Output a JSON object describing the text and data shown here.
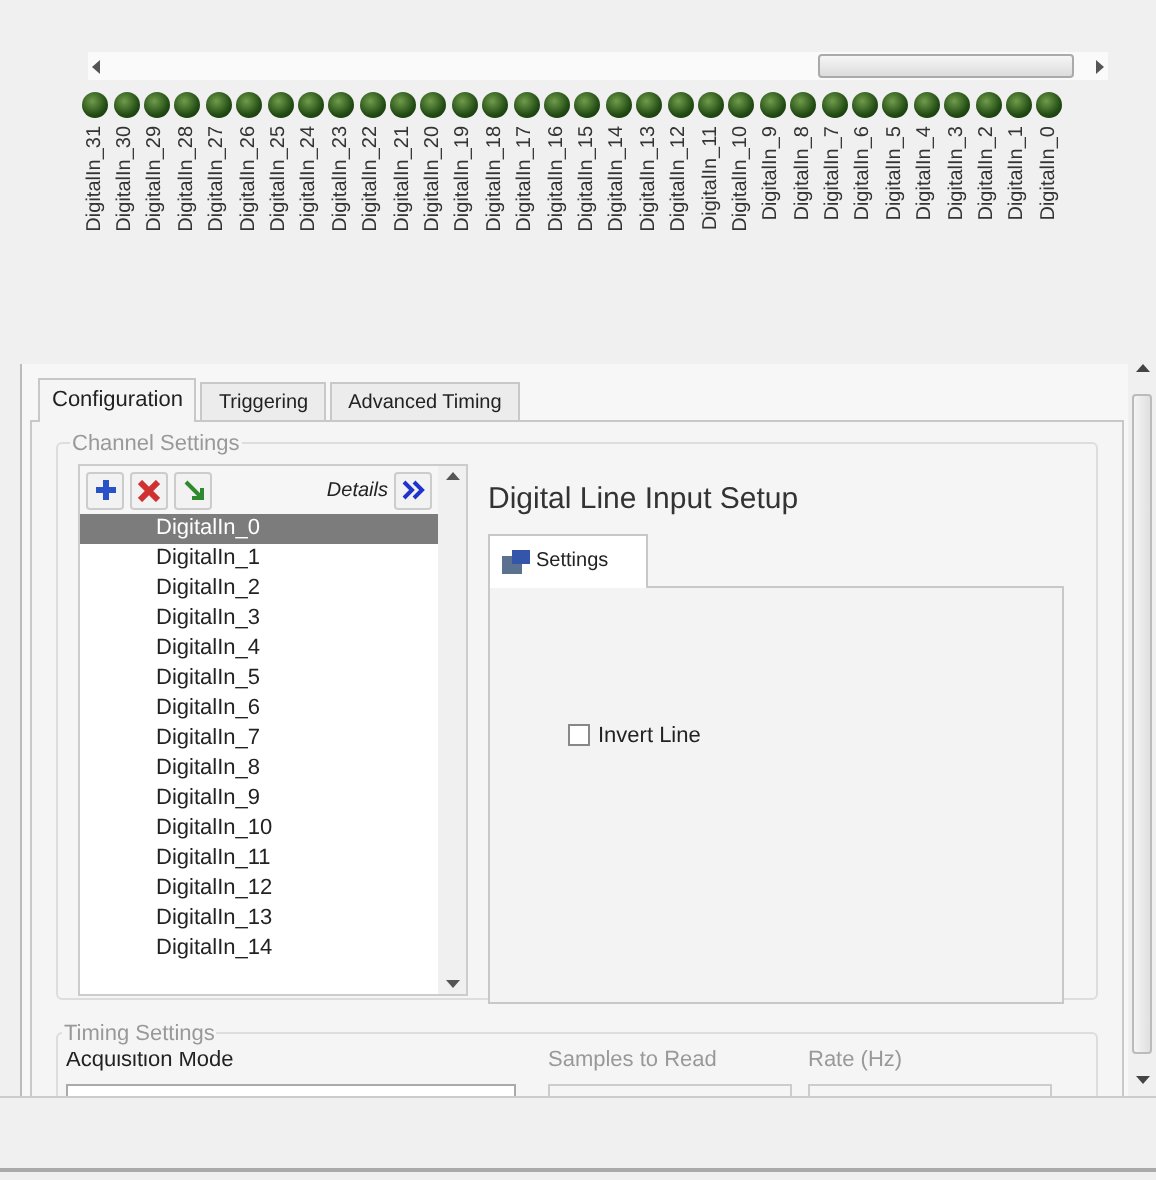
{
  "leds": [
    {
      "label": "DigitalIn_31",
      "on": false
    },
    {
      "label": "DigitalIn_30",
      "on": false
    },
    {
      "label": "DigitalIn_29",
      "on": false
    },
    {
      "label": "DigitalIn_28",
      "on": false
    },
    {
      "label": "DigitalIn_27",
      "on": false
    },
    {
      "label": "DigitalIn_26",
      "on": false
    },
    {
      "label": "DigitalIn_25",
      "on": false
    },
    {
      "label": "DigitalIn_24",
      "on": false
    },
    {
      "label": "DigitalIn_23",
      "on": false
    },
    {
      "label": "DigitalIn_22",
      "on": false
    },
    {
      "label": "DigitalIn_21",
      "on": false
    },
    {
      "label": "DigitalIn_20",
      "on": false
    },
    {
      "label": "DigitalIn_19",
      "on": false
    },
    {
      "label": "DigitalIn_18",
      "on": false
    },
    {
      "label": "DigitalIn_17",
      "on": false
    },
    {
      "label": "DigitalIn_16",
      "on": false
    },
    {
      "label": "DigitalIn_15",
      "on": false
    },
    {
      "label": "DigitalIn_14",
      "on": false
    },
    {
      "label": "DigitalIn_13",
      "on": false
    },
    {
      "label": "DigitalIn_12",
      "on": false
    },
    {
      "label": "DigitalIn_11",
      "on": false
    },
    {
      "label": "DigitalIn_10",
      "on": false
    },
    {
      "label": "DigitalIn_9",
      "on": false
    },
    {
      "label": "DigitalIn_8",
      "on": false
    },
    {
      "label": "DigitalIn_7",
      "on": false
    },
    {
      "label": "DigitalIn_6",
      "on": false
    },
    {
      "label": "DigitalIn_5",
      "on": false
    },
    {
      "label": "DigitalIn_4",
      "on": false
    },
    {
      "label": "DigitalIn_3",
      "on": false
    },
    {
      "label": "DigitalIn_2",
      "on": false
    },
    {
      "label": "DigitalIn_1",
      "on": false
    },
    {
      "label": "DigitalIn_0",
      "on": false
    }
  ],
  "tabs": [
    {
      "label": "Configuration",
      "selected": true
    },
    {
      "label": "Triggering",
      "selected": false
    },
    {
      "label": "Advanced Timing",
      "selected": false
    }
  ],
  "channel_settings": {
    "title": "Channel Settings",
    "details_label": "Details",
    "channels": [
      {
        "label": "DigitalIn_0",
        "selected": true
      },
      {
        "label": "DigitalIn_1",
        "selected": false
      },
      {
        "label": "DigitalIn_2",
        "selected": false
      },
      {
        "label": "DigitalIn_3",
        "selected": false
      },
      {
        "label": "DigitalIn_4",
        "selected": false
      },
      {
        "label": "DigitalIn_5",
        "selected": false
      },
      {
        "label": "DigitalIn_6",
        "selected": false
      },
      {
        "label": "DigitalIn_7",
        "selected": false
      },
      {
        "label": "DigitalIn_8",
        "selected": false
      },
      {
        "label": "DigitalIn_9",
        "selected": false
      },
      {
        "label": "DigitalIn_10",
        "selected": false
      },
      {
        "label": "DigitalIn_11",
        "selected": false
      },
      {
        "label": "DigitalIn_12",
        "selected": false
      },
      {
        "label": "DigitalIn_13",
        "selected": false
      },
      {
        "label": "DigitalIn_14",
        "selected": false
      }
    ],
    "setup_title": "Digital Line Input Setup",
    "setup_tab": "Settings",
    "invert_line": {
      "label": "Invert Line",
      "checked": false
    }
  },
  "timing_settings": {
    "title": "Timing Settings",
    "acquisition_mode_label": "Acquisition Mode",
    "samples_label": "Samples to Read",
    "rate_label": "Rate (Hz)"
  }
}
